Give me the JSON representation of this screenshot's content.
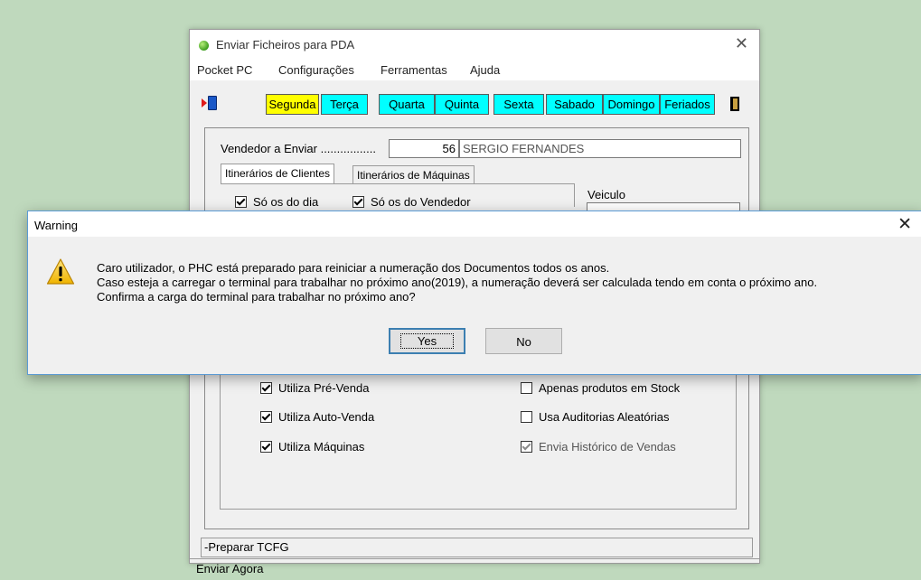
{
  "app": {
    "title": "Enviar Ficheiros para PDA",
    "close_glyph": "✕",
    "menu": [
      "Pocket PC",
      "Configurações",
      "Ferramentas",
      "Ajuda"
    ],
    "days": [
      "Segunda",
      "Terça",
      "Quarta",
      "Quinta",
      "Sexta",
      "Sabado",
      "Domingo",
      "Feriados"
    ],
    "active_day": "Segunda",
    "vendor_label": "Vendedor a Enviar .................",
    "vendor_code": "56",
    "vendor_name": "SERGIO FERNANDES",
    "tabs": [
      "Itinerários de Clientes",
      "Itinerários de Máquinas"
    ],
    "filters": [
      {
        "label": "Só os do dia",
        "checked": true
      },
      {
        "label": "Só os do Vendedor",
        "checked": true
      }
    ],
    "veiculo_label": "Veiculo",
    "options_left": [
      {
        "label": "Utiliza Pré-Venda",
        "checked": true
      },
      {
        "label": "Utiliza Auto-Venda",
        "checked": true
      },
      {
        "label": "Utiliza Máquinas",
        "checked": true
      }
    ],
    "options_right": [
      {
        "label": "Apenas produtos em Stock",
        "checked": false,
        "disabled": false
      },
      {
        "label": "Usa Auditorias Aleatórias",
        "checked": false,
        "disabled": false
      },
      {
        "label": "Envia Histórico de Vendas",
        "checked": true,
        "disabled": true
      }
    ],
    "prep_label": "-Preparar TCFG",
    "status": "Enviar Agora"
  },
  "warning": {
    "title": "Warning",
    "close_glyph": "✕",
    "icon": "warning-triangle-icon",
    "lines": [
      "Caro utilizador, o PHC está preparado para reiniciar a numeração dos Documentos todos os anos.",
      "Caso esteja a carregar o terminal para trabalhar no próximo ano(2019), a numeração deverá ser calculada tendo em conta o próximo ano.",
      "Confirma a carga do terminal para trabalhar no próximo ano?"
    ],
    "yes_label": "Yes",
    "no_label": "No"
  },
  "colors": {
    "desktop": "#bfd9bd",
    "day_button": "#00ffff",
    "day_button_active": "#ffff00",
    "dialog_border": "#5b9bd5"
  }
}
